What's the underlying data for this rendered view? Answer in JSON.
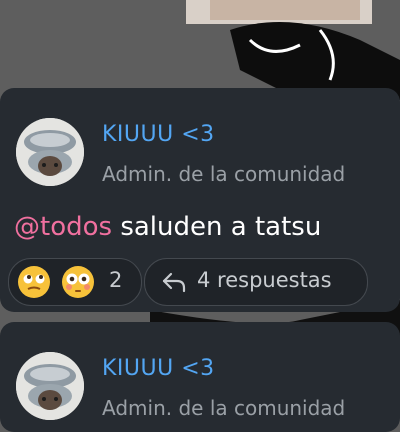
{
  "messages": [
    {
      "author": "KIUUU <3",
      "role": "Admin. de la comunidad",
      "mention": "@todos",
      "text": " saluden a tatsu",
      "reactions": {
        "emojis": [
          "face-with-rolling-eyes-icon",
          "flushed-face-icon"
        ],
        "count": "2"
      },
      "replies_label": "4 respuestas"
    },
    {
      "author": "KIUUU <3",
      "role": "Admin. de la comunidad"
    }
  ],
  "colors": {
    "card_bg": "#262b31",
    "author": "#53a6f3",
    "mention": "#f0709f",
    "muted": "#9aa0a6",
    "pill_border": "#44494f"
  }
}
